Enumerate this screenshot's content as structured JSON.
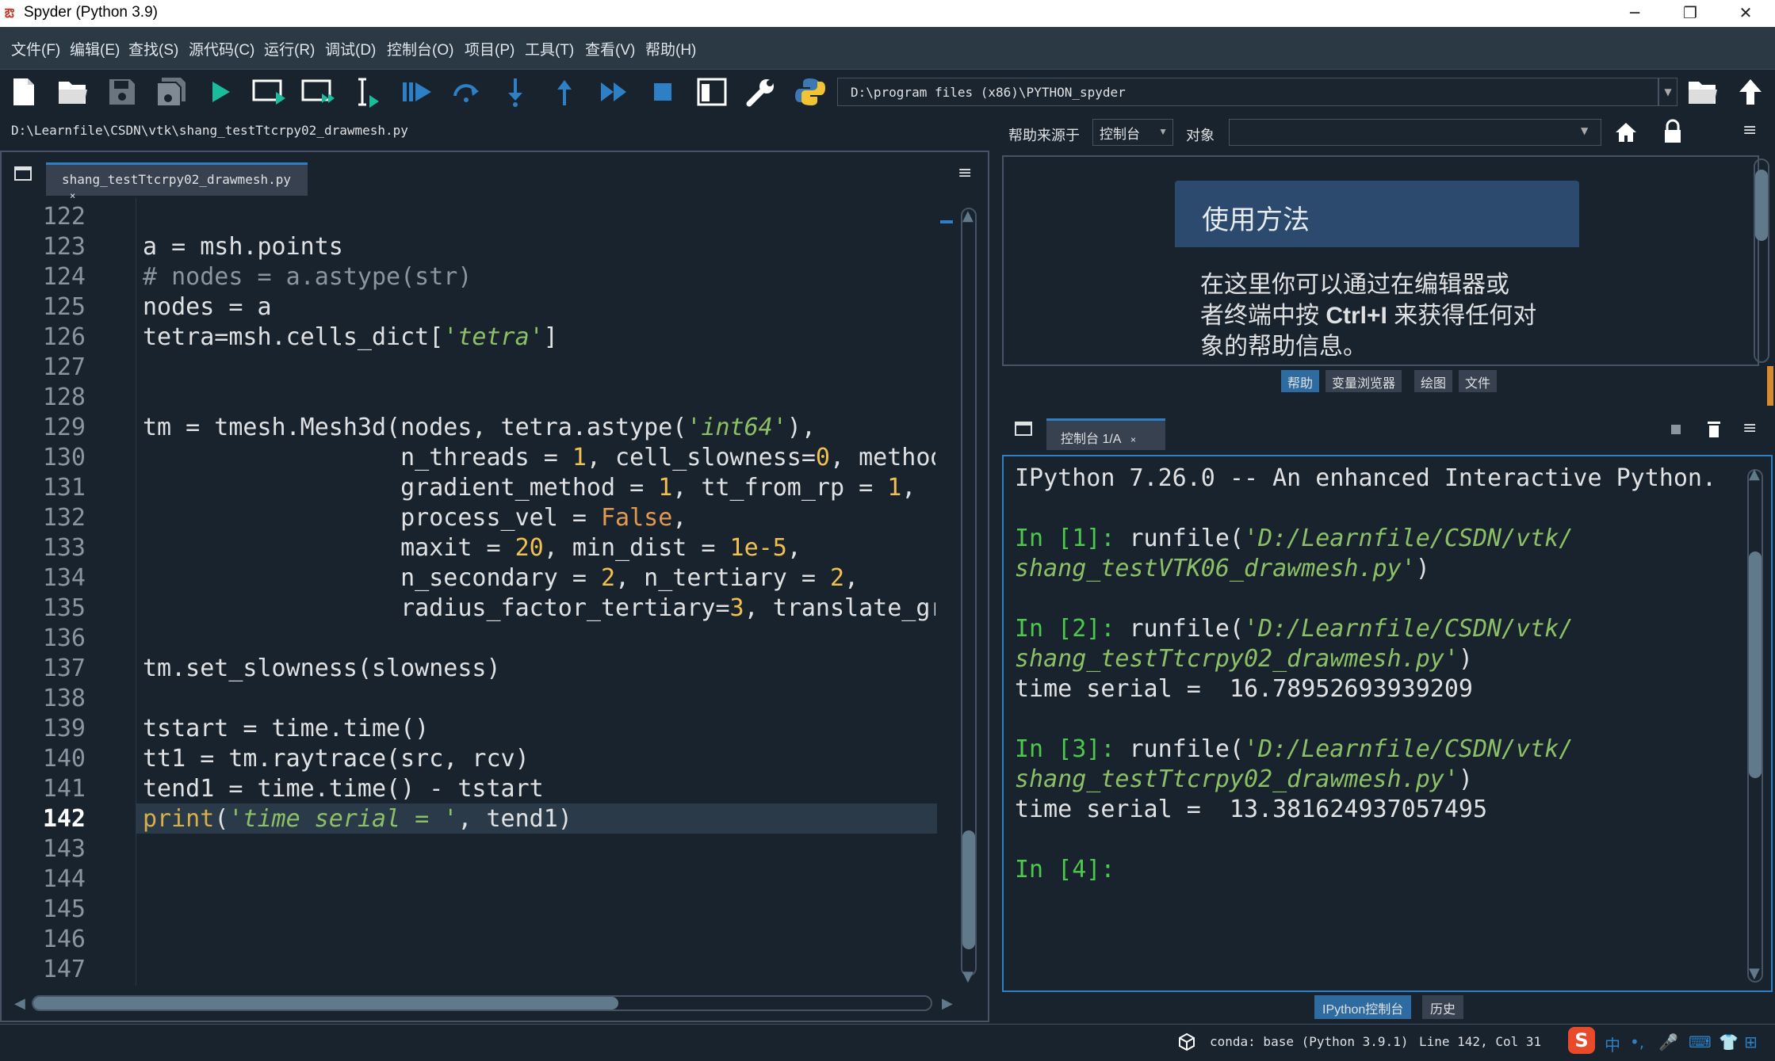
{
  "window": {
    "title": "Spyder (Python 3.9)"
  },
  "menubar": {
    "items": [
      "文件(F)",
      "编辑(E)",
      "查找(S)",
      "源代码(C)",
      "运行(R)",
      "调试(D)",
      "控制台(O)",
      "项目(P)",
      "工具(T)",
      "查看(V)",
      "帮助(H)"
    ]
  },
  "toolbar": {
    "working_dir": "D:\\program files (x86)\\PYTHON_spyder"
  },
  "editor": {
    "file_path": "D:\\Learnfile\\CSDN\\vtk\\shang_testTtcrpy02_drawmesh.py",
    "tab_label": "shang_testTtcrpy02_drawmesh.py",
    "tab_close": "×",
    "line_numbers": [
      "122",
      "123",
      "124",
      "125",
      "126",
      "127",
      "128",
      "129",
      "130",
      "131",
      "132",
      "133",
      "134",
      "135",
      "136",
      "137",
      "138",
      "139",
      "140",
      "141",
      "142",
      "143",
      "144",
      "145",
      "146",
      "147"
    ],
    "current_line": "142"
  },
  "help": {
    "source_label": "帮助来源于",
    "source_value": "控制台",
    "object_label": "对象",
    "object_value": "",
    "card_title": "使用方法",
    "card_text_1": "在这里你可以通过在编辑器或",
    "card_text_2a": "者终端中按 ",
    "card_text_2b": "Ctrl+I",
    "card_text_2c": " 来获得任何对",
    "card_text_3": "象的帮助信息。",
    "tabs": [
      "帮助",
      "变量浏览器",
      "绘图",
      "文件"
    ]
  },
  "console": {
    "tab_label": "控制台 1/A",
    "tab_close": "×",
    "banner": "IPython 7.26.0 -- An enhanced Interactive Python.",
    "in1_prompt": "In [1]:",
    "in1_call": " runfile(",
    "in1_arg_a": "'D:/Learnfile/CSDN/vtk/",
    "in1_arg_b": "shang_testVTK06_drawmesh.py'",
    "in2_prompt": "In [2]:",
    "in2_arg_a": "'D:/Learnfile/CSDN/vtk/",
    "in2_arg_b": "shang_testTtcrpy02_drawmesh.py'",
    "out2": "time serial =  16.78952693939209",
    "in3_prompt": "In [3]:",
    "in3_arg_a": "'D:/Learnfile/CSDN/vtk/",
    "in3_arg_b": "shang_testTtcrpy02_drawmesh.py'",
    "out3": "time serial =  13.381624937057495",
    "in4_prompt": "In [4]:",
    "bottom_tabs": [
      "IPython控制台",
      "历史"
    ]
  },
  "statusbar": {
    "env": "conda: base (Python 3.9.1)",
    "position": "Line 142, Col 31"
  },
  "colors": {
    "accent": "#2d80c5",
    "bg": "#19232d",
    "prompt_green": "#4cc84c",
    "string_green": "#8cc066"
  }
}
